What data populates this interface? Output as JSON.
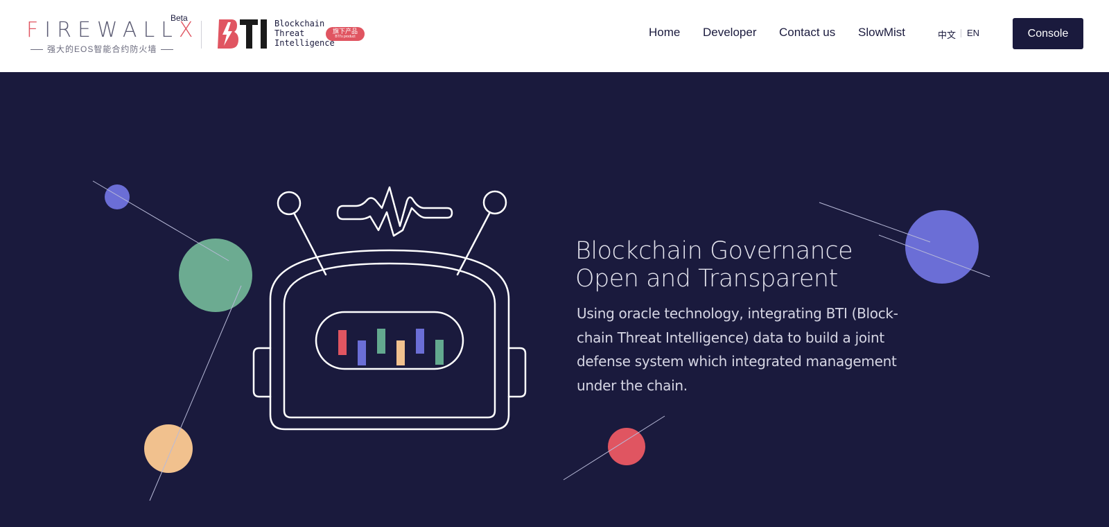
{
  "header": {
    "firewall_logo": {
      "text_accent_1": "F",
      "text_main": "IREWALL",
      "text_accent_2": "X",
      "beta": "Beta",
      "tagline": "强大的EOS智能合约防火墙"
    },
    "bti_logo": {
      "mark": "BTI",
      "line1": "Blockchain",
      "line2": "Threat",
      "line3": "Intelligence",
      "badge_cn": "旗下产品",
      "badge_en": "BTI's product"
    },
    "nav": [
      "Home",
      "Developer",
      "Contact us",
      "SlowMist"
    ],
    "lang": {
      "zh": "中文",
      "en": "EN"
    },
    "console_label": "Console"
  },
  "hero": {
    "title_line1": "Blockchain Governance",
    "title_line2": "Open and Transparent",
    "description": "Using oracle technology, integrating BTI (Block-chain Threat Intelligence) data to build a joint defense system which integrated management under the chain.",
    "bar_colors": [
      "#e05561",
      "#6b6ed6",
      "#63a98f",
      "#f1c18e",
      "#6b6ed6",
      "#63a98f"
    ],
    "circle_colors": {
      "blue": "#6b6ed6",
      "green": "#6cab91",
      "peach": "#f1c18e",
      "red": "#e05561"
    }
  }
}
